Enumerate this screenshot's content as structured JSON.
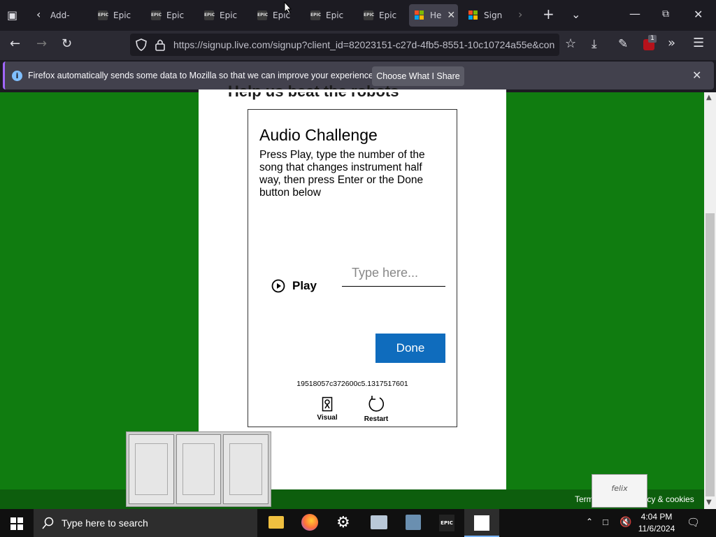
{
  "tabs": [
    {
      "title": "Add-",
      "icon": "add-tab-icon"
    },
    {
      "title": "Epic",
      "icon": "epic-icon"
    },
    {
      "title": "Epic",
      "icon": "epic-icon"
    },
    {
      "title": "Epic",
      "icon": "epic-icon"
    },
    {
      "title": "Epic",
      "icon": "epic-icon"
    },
    {
      "title": "Epic",
      "icon": "epic-icon"
    },
    {
      "title": "Epic",
      "icon": "epic-icon"
    },
    {
      "title": "He",
      "icon": "microsoft-icon",
      "active": true
    },
    {
      "title": "Sign",
      "icon": "microsoft-icon"
    }
  ],
  "epic_favicon_text": "EPIC",
  "address_bar": {
    "url": "https://signup.live.com/signup?client_id=82023151-c27d-4fb5-8551-10c10724a55e&con"
  },
  "extension_badge": "1",
  "notification": {
    "text": "Firefox automatically sends some data to Mozilla so that we can improve your experience.",
    "button": "Choose What I Share"
  },
  "page": {
    "heading": "Help us beat the robots",
    "background_color": "#107c10"
  },
  "captcha": {
    "title": "Audio Challenge",
    "instructions": "Press Play, type the number of the song that changes instrument half way, then press Enter or the Done button below",
    "play_label": "Play",
    "input_placeholder": "Type here...",
    "done_label": "Done",
    "session_id": "19518057c372600c5.1317517601",
    "visual_label": "Visual",
    "restart_label": "Restart",
    "done_color": "#0f6cbd"
  },
  "footer": {
    "terms": "Terms",
    "privacy": "rivacy & cookies"
  },
  "felix_label": "felix",
  "taskbar": {
    "search_placeholder": "Type here to search",
    "time": "4:04 PM",
    "date": "11/6/2024"
  }
}
